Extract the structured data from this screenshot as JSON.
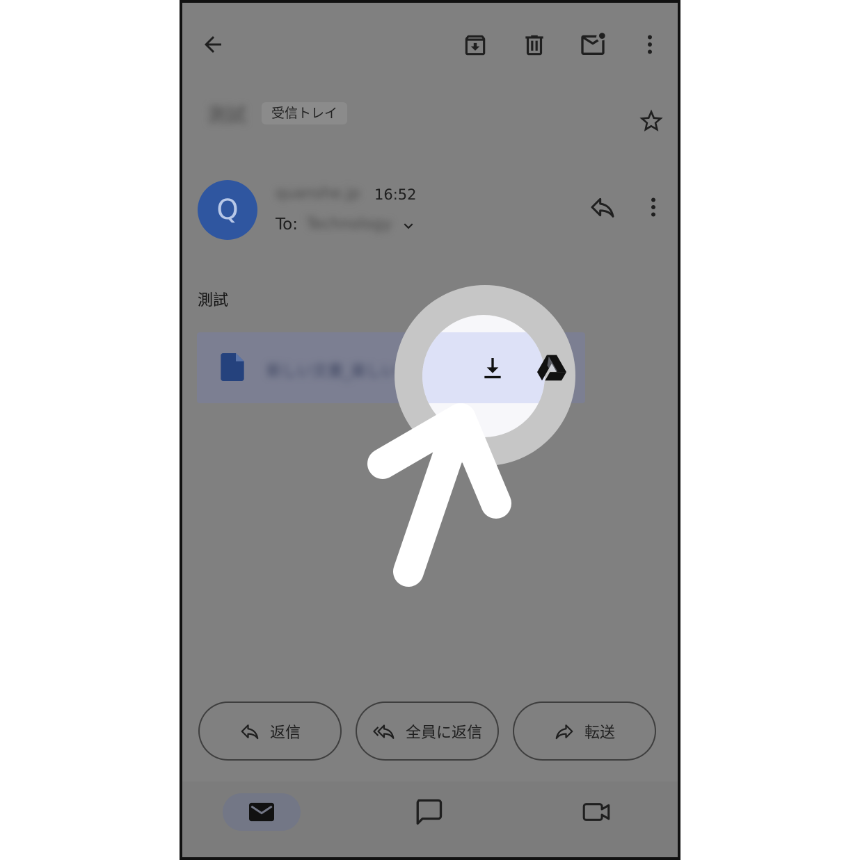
{
  "toolbar": {
    "back_icon": "arrow-left-icon",
    "archive_icon": "archive-icon",
    "delete_icon": "trash-icon",
    "unread_icon": "mail-unread-icon",
    "more_icon": "more-vert-icon"
  },
  "header": {
    "subject": "測試",
    "label": "受信トレイ",
    "star_icon": "star-outline-icon"
  },
  "message": {
    "avatar_letter": "Q",
    "sender": "quanshe.jp",
    "time": "16:52",
    "to_prefix": "To:",
    "to_value": "Technology",
    "body": "測試"
  },
  "attachment": {
    "name": "新しい文書_楽しいの",
    "file_icon": "document-icon",
    "download_icon": "download-icon",
    "drive_icon": "google-drive-icon"
  },
  "actions": {
    "reply": "返信",
    "reply_all": "全員に返信",
    "forward": "転送"
  },
  "bottom_nav": {
    "mail_icon": "mail-icon",
    "chat_icon": "chat-icon",
    "meet_icon": "video-icon"
  },
  "colors": {
    "overlay": "#808080",
    "avatar": "#2f56a0",
    "highlight": "#dde1f7"
  }
}
